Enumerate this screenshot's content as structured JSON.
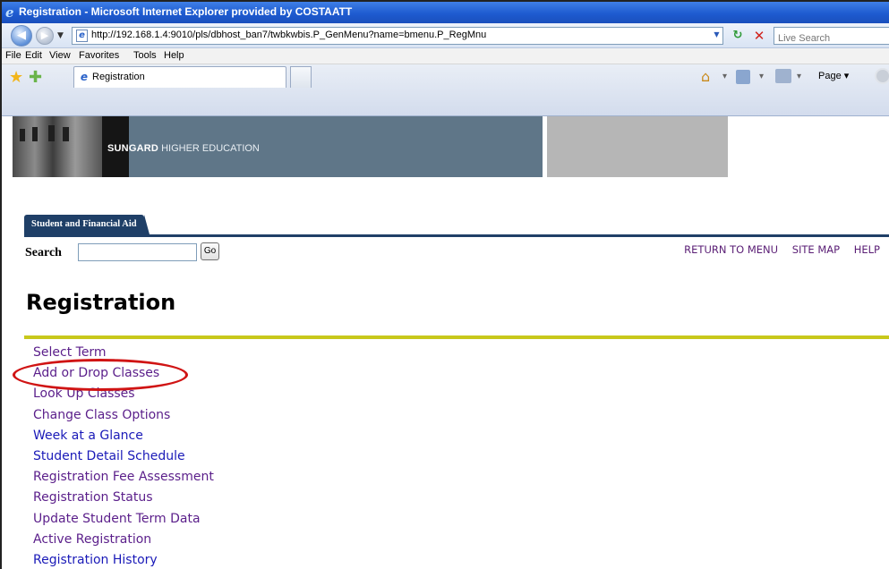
{
  "window": {
    "title": "Registration - Microsoft Internet Explorer provided by COSTAATT"
  },
  "address_bar": {
    "url": "http://192.168.1.4:9010/pls/dbhost_ban7/twbkwbis.P_GenMenu?name=bmenu.P_RegMnu",
    "search_placeholder": "Live Search"
  },
  "menu_bar": {
    "items": [
      "File",
      "Edit",
      "View",
      "Favorites",
      "Tools",
      "Help"
    ]
  },
  "tab_bar": {
    "tab_label": "Registration",
    "page_menu": "Page"
  },
  "banner": {
    "brand": "SUNGARD",
    "tagline": "HIGHER EDUCATION"
  },
  "nav": {
    "tab_label": "Student and Financial Aid"
  },
  "search": {
    "label": "Search",
    "button": "Go",
    "value": ""
  },
  "top_links": [
    "RETURN TO MENU",
    "SITE MAP",
    "HELP"
  ],
  "page": {
    "title": "Registration"
  },
  "menu_items": [
    {
      "label": "Select Term",
      "visited": true
    },
    {
      "label": "Add or Drop Classes",
      "visited": true,
      "highlighted": true
    },
    {
      "label": "Look Up Classes",
      "visited": true
    },
    {
      "label": "Change Class Options",
      "visited": true
    },
    {
      "label": "Week at a Glance",
      "visited": false
    },
    {
      "label": "Student Detail Schedule",
      "visited": false
    },
    {
      "label": "Registration Fee Assessment",
      "visited": true
    },
    {
      "label": "Registration Status",
      "visited": true
    },
    {
      "label": "Update Student Term Data",
      "visited": true
    },
    {
      "label": "Active Registration",
      "visited": true
    },
    {
      "label": "Registration History",
      "visited": false
    }
  ],
  "colors": {
    "title_bar": "#1e5bd0",
    "banner_blue": "#5f7688",
    "nav_tab": "#1f3f67",
    "rule": "#c8c81b",
    "visited_link": "#5a1e8a",
    "unvisited_link": "#1a1ab8",
    "annotation_circle": "#d01414"
  },
  "icons": {
    "back": "back-arrow-icon",
    "forward": "forward-arrow-icon",
    "refresh": "refresh-icon",
    "stop": "stop-icon",
    "favorites": "star-icon",
    "add_favorite": "add-favorite-icon",
    "home": "home-icon",
    "feeds": "rss-feed-icon",
    "print": "printer-icon",
    "tools": "gear-icon"
  }
}
